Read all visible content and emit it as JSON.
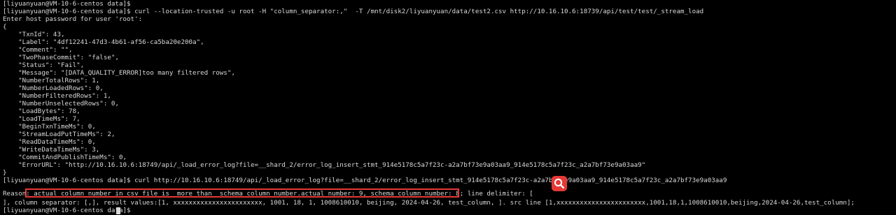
{
  "terminal": {
    "lines": [
      "[liyuanyuan@VM-10-6-centos data]$",
      "[liyuanyuan@VM-10-6-centos data]$ curl --location-trusted -u root -H \"column_separator:,\"  -T /mnt/disk2/liyuanyuan/data/test2.csv http://10.16.10.6:18739/api/test/test/_stream_load",
      "Enter host password for user 'root':",
      "{",
      "    \"TxnId\": 43,",
      "    \"Label\": \"4df12241-47d3-4b61-af56-ca5ba20e200a\",",
      "    \"Comment\": \"\",",
      "    \"TwoPhaseCommit\": \"false\",",
      "    \"Status\": \"Fail\",",
      "    \"Message\": \"[DATA_QUALITY_ERROR]too many filtered rows\",",
      "    \"NumberTotalRows\": 1,",
      "    \"NumberLoadedRows\": 0,",
      "    \"NumberFilteredRows\": 1,",
      "    \"NumberUnselectedRows\": 0,",
      "    \"LoadBytes\": 78,",
      "    \"LoadTimeMs\": 7,",
      "    \"BeginTxnTimeMs\": 0,",
      "    \"StreamLoadPutTimeMs\": 2,",
      "    \"ReadDataTimeMs\": 0,",
      "    \"WriteDataTimeMs\": 3,",
      "    \"CommitAndPublishTimeMs\": 0,",
      "    \"ErrorURL\": \"http://10.16.10.6:18749/api/_load_error_log?file=__shard_2/error_log_insert_stmt_914e5178c5a7f23c-a2a7bf73e9a03aa9_914e5178c5a7f23c_a2a7bf73e9a03aa9\"",
      "}",
      "[liyuanyuan@VM-10-6-centos data]$ curl http://10.16.10.6:18749/api/_load_error_log?file=__shard_2/error_log_insert_stmt_914e5178c5a7f23c-a2a7bf73e9a03aa9_914e5178c5a7f23c_a2a7bf73e9a03aa9",
      "Reason: actual column number in csv file is  more than  schema column number.actual number: 9, schema column number: 8; line delimiter: [",
      "], column separator: [,], result values:[1, xxxxxxxxxxxxxxxxxxxxxxx, 1001, 18, 1, 1008610010, beijing, 2024-04-26, test_column, ]. src line [1,xxxxxxxxxxxxxxxxxxxxxxx,1001,18,1,1008610010,beijing,2024-04-26,test_column];",
      "[liyuanyuan@VM-10-6-centos data]$ "
    ]
  },
  "colors": {
    "background": "#000000",
    "text": "#d9d9d9",
    "highlight": "#e53935"
  },
  "icons": {
    "search_badge": "search-icon"
  }
}
